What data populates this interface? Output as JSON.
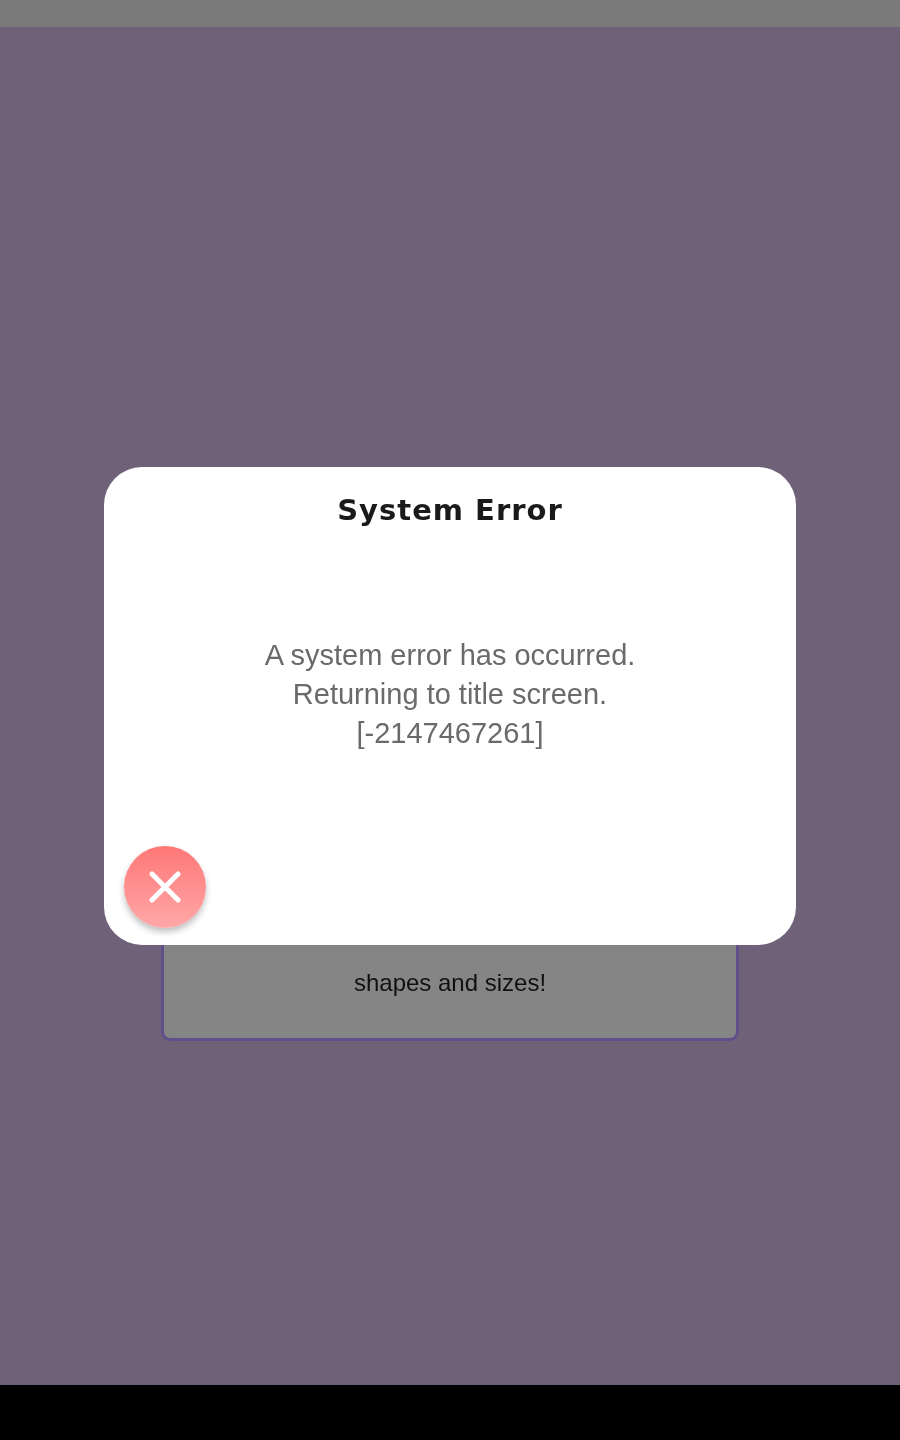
{
  "background_card": {
    "lines": [
      "shapes and sizes!"
    ]
  },
  "dialog": {
    "title": "System Error",
    "message": [
      "A system error has occurred.",
      "Returning to title screen.",
      "[-2147467261]"
    ]
  }
}
